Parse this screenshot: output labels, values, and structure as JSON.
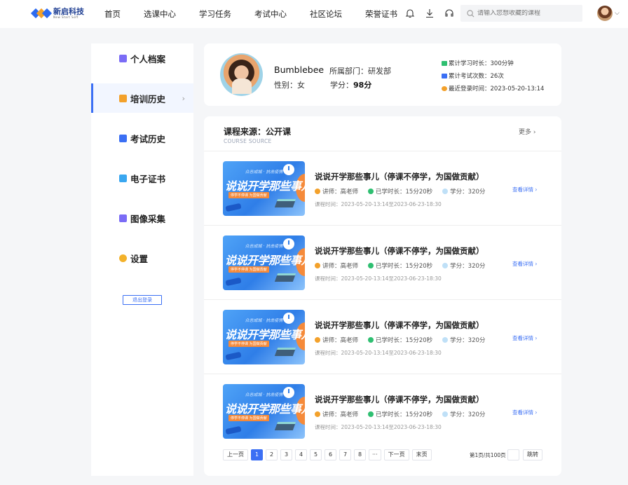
{
  "header": {
    "logo_cn": "新启科技",
    "logo_en": "New Start Soft",
    "nav": [
      "首页",
      "选课中心",
      "学习任务",
      "考试中心",
      "社区论坛",
      "荣誉证书"
    ],
    "search_placeholder": "请输入您想收藏的课程"
  },
  "sidebar": {
    "items": [
      {
        "label": "个人档案",
        "icon": "profile-icon",
        "color": "#7b6cf6"
      },
      {
        "label": "培训历史",
        "icon": "graduation-cap-icon",
        "color": "#f3a12b"
      },
      {
        "label": "考试历史",
        "icon": "exam-doc-icon",
        "color": "#3b6ff4"
      },
      {
        "label": "电子证书",
        "icon": "certificate-icon",
        "color": "#3aa7f0"
      },
      {
        "label": "图像采集",
        "icon": "camera-icon",
        "color": "#7b6cf6"
      },
      {
        "label": "设置",
        "icon": "gear-icon",
        "color": "#f3b22b"
      }
    ],
    "active_index": 1,
    "arrow": "›",
    "logout_label": "退出登录"
  },
  "profile": {
    "name": "Bumblebee",
    "dept": "所属部门：研发部",
    "gender": "性别：女",
    "score_label": "学分：",
    "score_value": "98分",
    "stats": [
      {
        "text": "累计学习时长：300分钟",
        "color": "#2fbf71"
      },
      {
        "text": "累计考试次数：26次",
        "color": "#3b6ff4"
      },
      {
        "text": "最近登录时间：2023-05-20-13:14",
        "color": "#f3a12b"
      }
    ]
  },
  "courses": {
    "title": "课程来源：公开课",
    "subtitle": "COURSE SOURCE",
    "more": "更多 ›",
    "items": [
      {
        "title": "说说开学那些事儿（停课不停学，为国做贡献）",
        "teacher": "讲师：高老师",
        "duration": "已学时长：15分20秒",
        "credit": "学分：320分",
        "time": "课程时间：2023-05-20-13:14至2023-06-23-18:30",
        "detail": "查看详情 ›",
        "thumb_top": "众志成城 · 抗击疫情",
        "thumb_main": "说说开学那些事儿",
        "thumb_pill": "停学不停课  为国做贡献"
      },
      {
        "title": "说说开学那些事儿（停课不停学，为国做贡献）",
        "teacher": "讲师：高老师",
        "duration": "已学时长：15分20秒",
        "credit": "学分：320分",
        "time": "课程时间：2023-05-20-13:14至2023-06-23-18:30",
        "detail": "查看详情 ›",
        "thumb_top": "众志成城 · 抗击疫情",
        "thumb_main": "说说开学那些事儿",
        "thumb_pill": "停学不停课  为国做贡献"
      },
      {
        "title": "说说开学那些事儿（停课不停学，为国做贡献）",
        "teacher": "讲师：高老师",
        "duration": "已学时长：15分20秒",
        "credit": "学分：320分",
        "time": "课程时间：2023-05-20-13:14至2023-06-23-18:30",
        "detail": "查看详情 ›",
        "thumb_top": "众志成城 · 抗击疫情",
        "thumb_main": "说说开学那些事儿",
        "thumb_pill": "停学不停课  为国做贡献"
      },
      {
        "title": "说说开学那些事儿（停课不停学，为国做贡献）",
        "teacher": "讲师：高老师",
        "duration": "已学时长：15分20秒",
        "credit": "学分：320分",
        "time": "课程时间：2023-05-20-13:14至2023-06-23-18:30",
        "detail": "查看详情 ›",
        "thumb_top": "众志成城 · 抗击疫情",
        "thumb_main": "说说开学那些事儿",
        "thumb_pill": "停学不停课  为国做贡献"
      }
    ]
  },
  "pagination": {
    "prev": "上一页",
    "pages": [
      "1",
      "2",
      "3",
      "4",
      "5",
      "6",
      "7",
      "8",
      "···"
    ],
    "active": "1",
    "next": "下一页",
    "last": "末页",
    "info": "第1页/共100页",
    "go": "跳转"
  },
  "colors": {
    "accent": "#3b6ff4",
    "orange": "#f3a12b",
    "green": "#2fbf71"
  }
}
